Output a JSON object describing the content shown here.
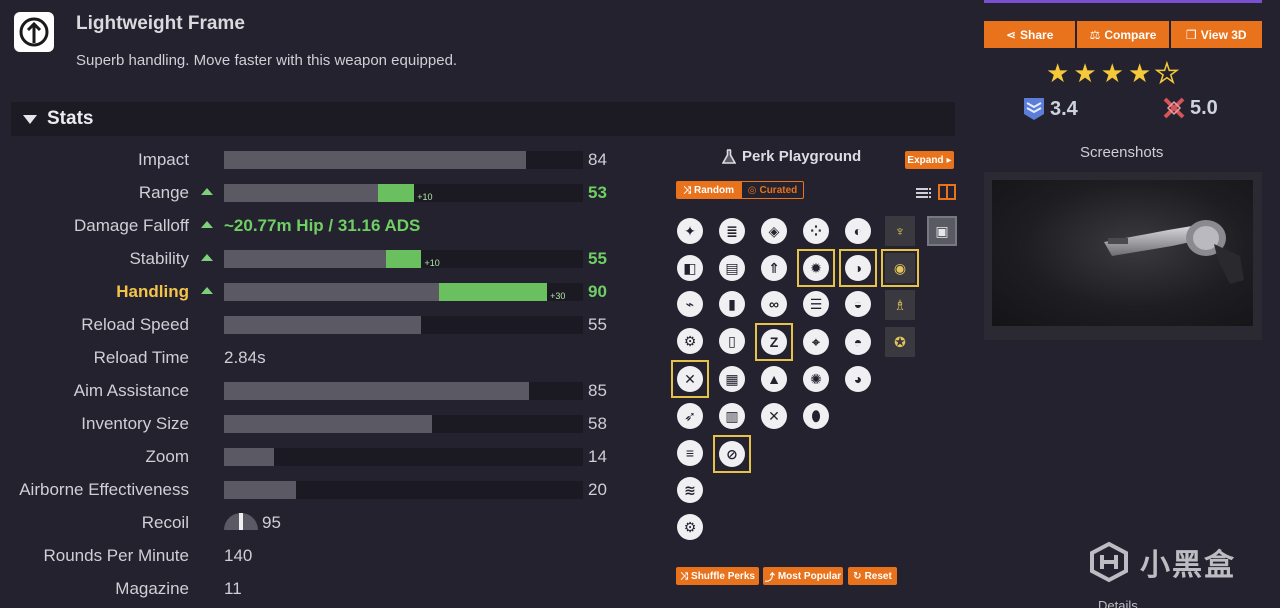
{
  "frame": {
    "icon": "lightweight-frame-icon",
    "title": "Lightweight Frame",
    "description": "Superb handling. Move faster with this weapon equipped."
  },
  "stats_section": {
    "title": "Stats",
    "rows": [
      {
        "label": "Impact",
        "value": "84",
        "fill": 84
      },
      {
        "label": "Range",
        "value": "53",
        "bonus": "+10",
        "fill_base": 43,
        "fill_bonus": 10
      },
      {
        "label": "Damage Falloff",
        "text": "~20.77m Hip / 31.16 ADS"
      },
      {
        "label": "Stability",
        "value": "55",
        "bonus": "+10",
        "fill_base": 45,
        "fill_bonus": 10
      },
      {
        "label": "Handling",
        "value": "90",
        "bonus": "+30",
        "fill_base": 60,
        "fill_bonus": 30
      },
      {
        "label": "Reload Speed",
        "value": "55",
        "fill": 55
      },
      {
        "label": "Reload Time",
        "text": "2.84s"
      },
      {
        "label": "Aim Assistance",
        "value": "85",
        "fill": 85
      },
      {
        "label": "Inventory Size",
        "value": "58",
        "fill": 58
      },
      {
        "label": "Zoom",
        "value": "14",
        "fill": 14
      },
      {
        "label": "Airborne Effectiveness",
        "value": "20",
        "fill": 20
      },
      {
        "label": "Recoil",
        "value": "95"
      },
      {
        "label": "Rounds Per Minute",
        "text": "140"
      },
      {
        "label": "Magazine",
        "text": "11"
      }
    ]
  },
  "perk_playground": {
    "title": "Perk Playground",
    "flask_icon": "flask-icon",
    "expand_label": "Expand",
    "mode_random": "Random",
    "mode_curated": "Curated",
    "list_icon": "list-view-icon",
    "grid_icon": "grid-view-icon",
    "shuffle_label": "Shuffle Perks",
    "popular_label": "Most Popular",
    "reset_label": "Reset"
  },
  "share_bar": {
    "share": "Share",
    "compare": "Compare",
    "view3d": "View 3D"
  },
  "rating": {
    "stars": 4,
    "stars_max": 5,
    "score_a": "3.4",
    "score_b": "5.0"
  },
  "screenshots": {
    "title": "Screenshots"
  },
  "details_label": "Details",
  "watermark": {
    "text": "小黑盒"
  },
  "colors": {
    "background": "#24222e",
    "accent": "#e8731c",
    "bonus_green": "#6abf5f",
    "highlight_yellow": "#f4c44a",
    "bar_base": "#5a5964"
  }
}
